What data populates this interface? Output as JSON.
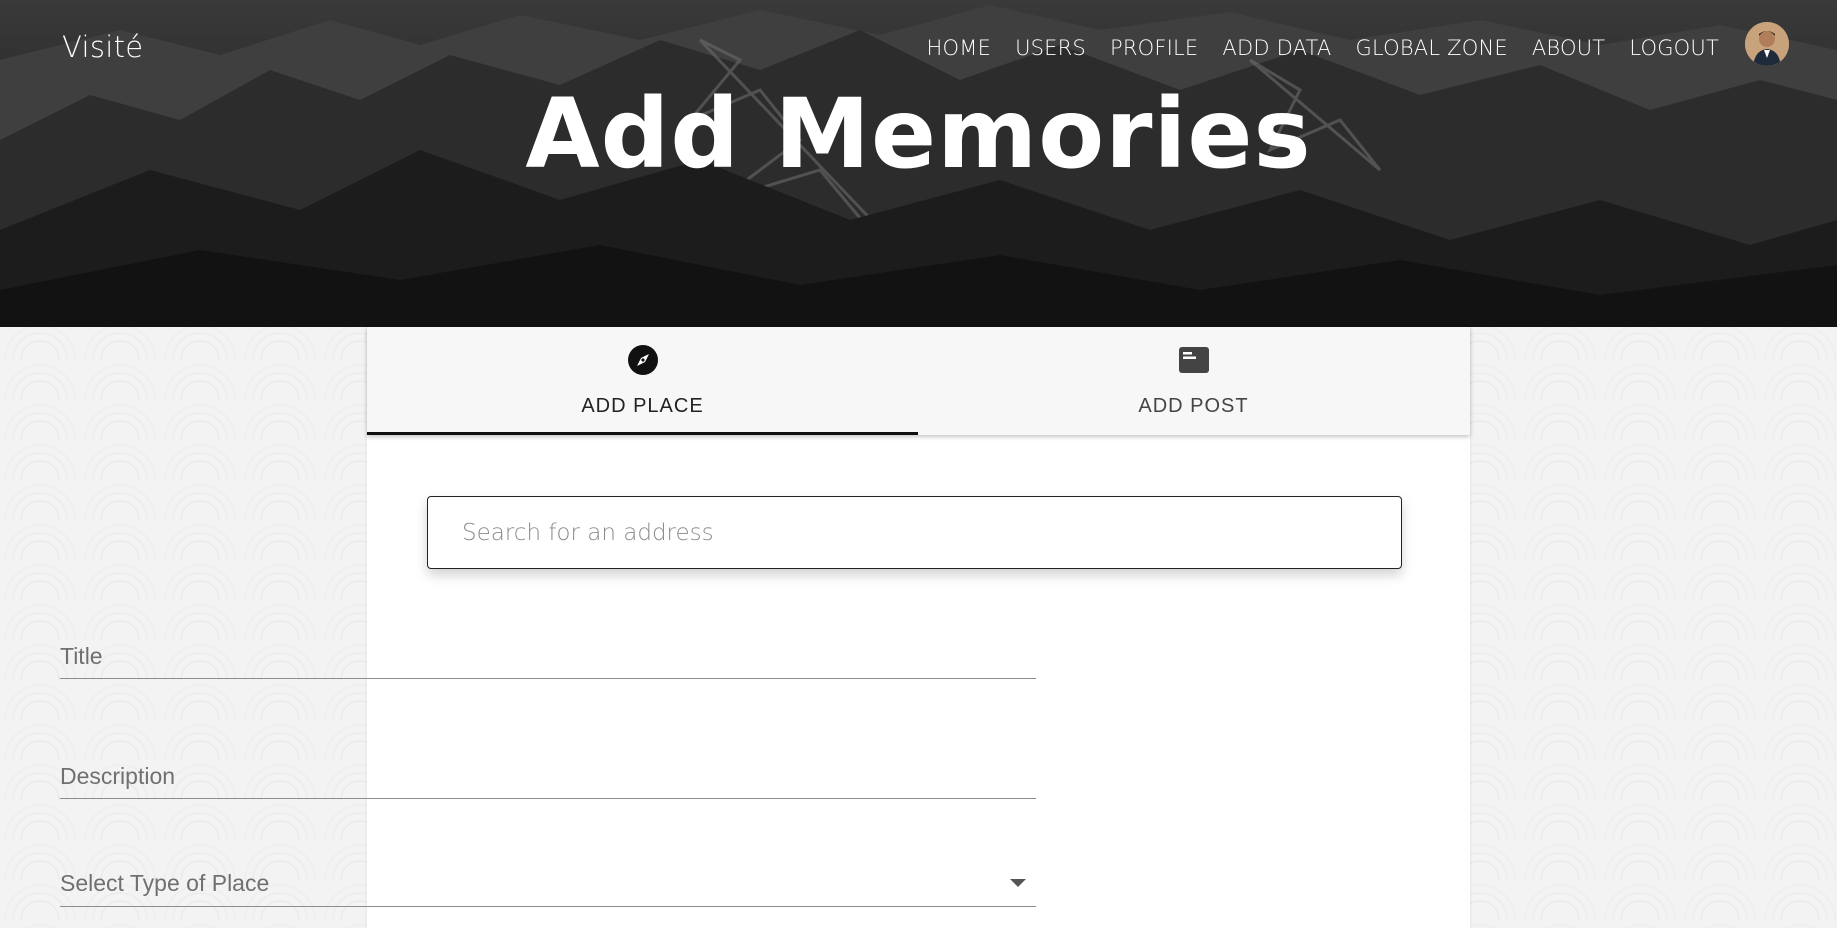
{
  "header": {
    "brand": "Visité",
    "nav": [
      {
        "label": "HOME"
      },
      {
        "label": "USERS"
      },
      {
        "label": "PROFILE"
      },
      {
        "label": "ADD DATA"
      },
      {
        "label": "GLOBAL ZONE"
      },
      {
        "label": "ABOUT"
      },
      {
        "label": "LOGOUT"
      }
    ],
    "avatar_icon": "user-avatar"
  },
  "hero": {
    "title": "Add Memories"
  },
  "tabs": [
    {
      "label": "ADD PLACE",
      "icon": "compass-icon",
      "active": true
    },
    {
      "label": "ADD POST",
      "icon": "card-icon",
      "active": false
    }
  ],
  "form": {
    "search": {
      "placeholder": "Search for an address",
      "value": ""
    },
    "title": {
      "placeholder": "Title",
      "value": ""
    },
    "description": {
      "placeholder": "Description",
      "value": ""
    },
    "type_select": {
      "label": "Select Type of Place",
      "icon": "arrow-drop-down-icon"
    }
  }
}
